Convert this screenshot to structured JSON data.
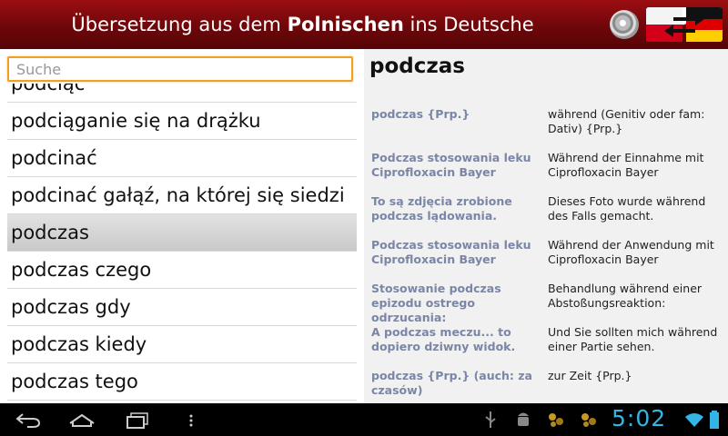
{
  "header": {
    "title_prefix": "Übersetzung aus dem ",
    "title_source_lang": "Polnischen",
    "title_middle": " ins ",
    "title_target_lang": "Deutsche"
  },
  "search": {
    "placeholder": "Suche",
    "value": ""
  },
  "word_list": [
    "podciąć",
    "podciąganie się na drążku",
    "podcinać",
    "podcinać gałąź, na której się siedzi",
    "podczas",
    "podczas czego",
    "podczas gdy",
    "podczas kiedy",
    "podczas tego"
  ],
  "selected_index": 4,
  "entry": {
    "headword": "podczas",
    "translations": [
      {
        "source": "podczas {Prp.}",
        "target": "während (Genitiv oder fam: Dativ) {Prp.}"
      },
      {
        "source": "Podczas stosowania leku Ciprofloxacin Bayer",
        "target": "Während der Einnahme mit Ciprofloxacin Bayer"
      },
      {
        "source": "To są zdjęcia zrobione podczas lądowania.",
        "target": "Dieses Foto wurde während des Falls gemacht."
      },
      {
        "source": "Podczas stosowania leku Ciprofloxacin Bayer",
        "target": "Während der Anwendung mit Ciprofloxacin Bayer"
      },
      {
        "source": "Stosowanie podczas epizodu ostrego odrzucania:",
        "target": "Behandlung während einer Abstoßungsreaktion:"
      },
      {
        "source": "A podczas meczu... to dopiero dziwny widok.",
        "target": "Und Sie sollten mich während einer Partie sehen."
      },
      {
        "source": "podczas {Prp.} (auch: za czasów)",
        "target": "zur Zeit {Prp.}"
      }
    ]
  },
  "status": {
    "time": "5:02"
  },
  "colors": {
    "header": "#7a090c",
    "accent": "#33b5e5",
    "search_border": "#f0a020",
    "source_text": "#7a86a8"
  },
  "icons": [
    "speaker-icon",
    "language-swap-icon",
    "back-icon",
    "home-icon",
    "recent-apps-icon",
    "menu-icon",
    "usb-icon",
    "android-debug-icon",
    "notification-icon",
    "wifi-icon",
    "battery-icon"
  ]
}
